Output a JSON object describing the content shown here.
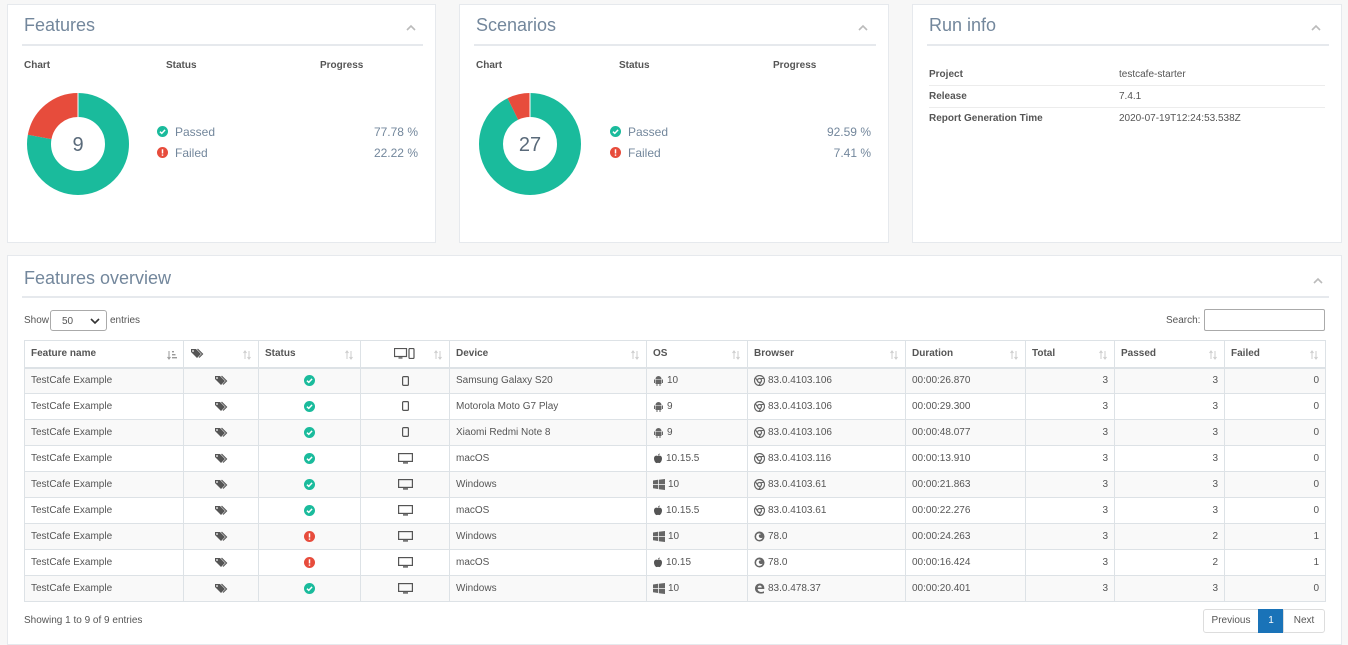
{
  "features_panel": {
    "title": "Features",
    "col_chart": "Chart",
    "col_status": "Status",
    "col_progress": "Progress",
    "total": "9",
    "passed_label": "Passed",
    "passed_pct": "77.78 %",
    "failed_label": "Failed",
    "failed_pct": "22.22 %",
    "passed_fraction": 0.7778
  },
  "scenarios_panel": {
    "title": "Scenarios",
    "col_chart": "Chart",
    "col_status": "Status",
    "col_progress": "Progress",
    "total": "27",
    "passed_label": "Passed",
    "passed_pct": "92.59 %",
    "failed_label": "Failed",
    "failed_pct": "7.41 %",
    "passed_fraction": 0.9259
  },
  "run_info": {
    "title": "Run info",
    "rows": [
      {
        "key": "Project",
        "value": "testcafe-starter"
      },
      {
        "key": "Release",
        "value": "7.4.1"
      },
      {
        "key": "Report Generation Time",
        "value": "2020-07-19T12:24:53.538Z"
      }
    ]
  },
  "overview": {
    "title": "Features overview",
    "show_label": "Show",
    "entries_value": "50",
    "entries_label": "entries",
    "search_label": "Search:",
    "search_value": "",
    "headers": {
      "feature": "Feature name",
      "status": "Status",
      "device": "Device",
      "os": "OS",
      "browser": "Browser",
      "duration": "Duration",
      "total": "Total",
      "passed": "Passed",
      "failed": "Failed"
    },
    "rows": [
      {
        "name": "TestCafe Example",
        "status": "passed",
        "devtype": "mobile",
        "device": "Samsung Galaxy S20",
        "osicon": "android",
        "os": "10",
        "bricon": "chrome",
        "browser": "83.0.4103.106",
        "duration": "00:00:26.870",
        "total": "3",
        "passed": "3",
        "failed": "0"
      },
      {
        "name": "TestCafe Example",
        "status": "passed",
        "devtype": "mobile",
        "device": "Motorola Moto G7 Play",
        "osicon": "android",
        "os": "9",
        "bricon": "chrome",
        "browser": "83.0.4103.106",
        "duration": "00:00:29.300",
        "total": "3",
        "passed": "3",
        "failed": "0"
      },
      {
        "name": "TestCafe Example",
        "status": "passed",
        "devtype": "mobile",
        "device": "Xiaomi Redmi Note 8",
        "osicon": "android",
        "os": "9",
        "bricon": "chrome",
        "browser": "83.0.4103.106",
        "duration": "00:00:48.077",
        "total": "3",
        "passed": "3",
        "failed": "0"
      },
      {
        "name": "TestCafe Example",
        "status": "passed",
        "devtype": "desktop",
        "device": "macOS",
        "osicon": "apple",
        "os": "10.15.5",
        "bricon": "chrome",
        "browser": "83.0.4103.116",
        "duration": "00:00:13.910",
        "total": "3",
        "passed": "3",
        "failed": "0"
      },
      {
        "name": "TestCafe Example",
        "status": "passed",
        "devtype": "desktop",
        "device": "Windows",
        "osicon": "windows",
        "os": "10",
        "bricon": "chrome",
        "browser": "83.0.4103.61",
        "duration": "00:00:21.863",
        "total": "3",
        "passed": "3",
        "failed": "0"
      },
      {
        "name": "TestCafe Example",
        "status": "passed",
        "devtype": "desktop",
        "device": "macOS",
        "osicon": "apple",
        "os": "10.15.5",
        "bricon": "chrome",
        "browser": "83.0.4103.61",
        "duration": "00:00:22.276",
        "total": "3",
        "passed": "3",
        "failed": "0"
      },
      {
        "name": "TestCafe Example",
        "status": "failed",
        "devtype": "desktop",
        "device": "Windows",
        "osicon": "windows",
        "os": "10",
        "bricon": "firefox",
        "browser": "78.0",
        "duration": "00:00:24.263",
        "total": "3",
        "passed": "2",
        "failed": "1"
      },
      {
        "name": "TestCafe Example",
        "status": "failed",
        "devtype": "desktop",
        "device": "macOS",
        "osicon": "apple",
        "os": "10.15",
        "bricon": "firefox",
        "browser": "78.0",
        "duration": "00:00:16.424",
        "total": "3",
        "passed": "2",
        "failed": "1"
      },
      {
        "name": "TestCafe Example",
        "status": "passed",
        "devtype": "desktop",
        "device": "Windows",
        "osicon": "windows",
        "os": "10",
        "bricon": "edge",
        "browser": "83.0.478.37",
        "duration": "00:00:20.401",
        "total": "3",
        "passed": "3",
        "failed": "0"
      }
    ],
    "info": "Showing 1 to 9 of 9 entries",
    "prev_label": "Previous",
    "page_label": "1",
    "next_label": "Next"
  },
  "colors": {
    "passed": "#1abb9c",
    "failed": "#e74c3c",
    "link": "#1a73b8",
    "page_active": "#1a73b8"
  }
}
